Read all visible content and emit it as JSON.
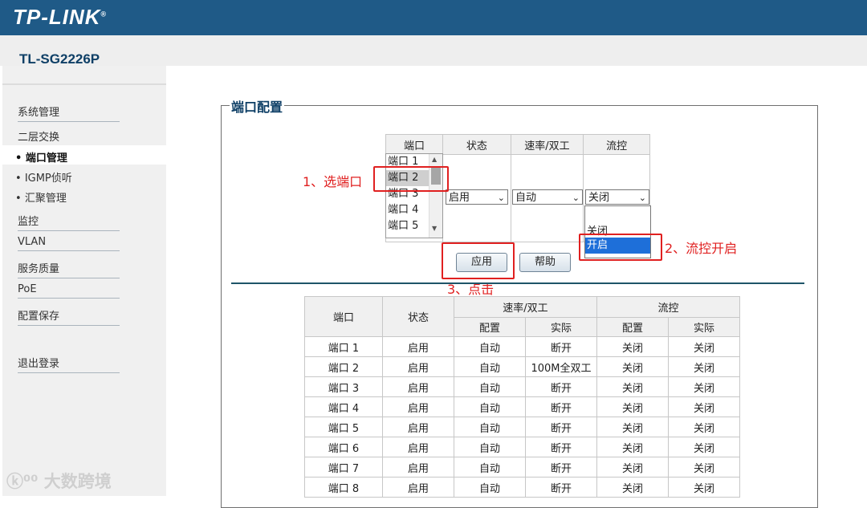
{
  "brand": "TP-LINK",
  "model": "TL-SG2226P",
  "sidebar": {
    "items": [
      {
        "label": "系统管理"
      },
      {
        "label": "二层交换"
      },
      {
        "label": "监控"
      },
      {
        "label": "VLAN"
      },
      {
        "label": "服务质量"
      },
      {
        "label": "PoE"
      },
      {
        "label": "配置保存"
      },
      {
        "label": "退出登录"
      }
    ],
    "subitems": [
      {
        "label": "端口管理",
        "active": true
      },
      {
        "label": "IGMP侦听",
        "active": false
      },
      {
        "label": "汇聚管理",
        "active": false
      }
    ]
  },
  "panel_title": "端口配置",
  "config": {
    "headers": [
      "端口",
      "状态",
      "速率/双工",
      "流控"
    ],
    "port_list": [
      "端口 1",
      "端口 2",
      "端口 3",
      "端口 4",
      "端口 5"
    ],
    "selected_port": "端口 2",
    "status_value": "启用",
    "speed_value": "自动",
    "flow_value": "关闭",
    "flow_options": [
      "关闭",
      "开启"
    ],
    "flow_highlighted": "开启",
    "apply_label": "应用",
    "help_label": "帮助"
  },
  "annotations": {
    "step1": "1、选端口",
    "step2": "2、流控开启",
    "step3": "3、点击"
  },
  "status_table": {
    "headers": {
      "port": "端口",
      "status": "状态",
      "speed": "速率/双工",
      "flow": "流控",
      "config": "配置",
      "actual": "实际"
    },
    "rows": [
      {
        "port": "端口 1",
        "status": "启用",
        "speed_cfg": "自动",
        "speed_act": "断开",
        "flow_cfg": "关闭",
        "flow_act": "关闭"
      },
      {
        "port": "端口 2",
        "status": "启用",
        "speed_cfg": "自动",
        "speed_act": "100M全双工",
        "flow_cfg": "关闭",
        "flow_act": "关闭"
      },
      {
        "port": "端口 3",
        "status": "启用",
        "speed_cfg": "自动",
        "speed_act": "断开",
        "flow_cfg": "关闭",
        "flow_act": "关闭"
      },
      {
        "port": "端口 4",
        "status": "启用",
        "speed_cfg": "自动",
        "speed_act": "断开",
        "flow_cfg": "关闭",
        "flow_act": "关闭"
      },
      {
        "port": "端口 5",
        "status": "启用",
        "speed_cfg": "自动",
        "speed_act": "断开",
        "flow_cfg": "关闭",
        "flow_act": "关闭"
      },
      {
        "port": "端口 6",
        "status": "启用",
        "speed_cfg": "自动",
        "speed_act": "断开",
        "flow_cfg": "关闭",
        "flow_act": "关闭"
      },
      {
        "port": "端口 7",
        "status": "启用",
        "speed_cfg": "自动",
        "speed_act": "断开",
        "flow_cfg": "关闭",
        "flow_act": "关闭"
      },
      {
        "port": "端口 8",
        "status": "启用",
        "speed_cfg": "自动",
        "speed_act": "断开",
        "flow_cfg": "关闭",
        "flow_act": "关闭"
      }
    ]
  },
  "watermark": "大数跨境",
  "colors": {
    "header": "#1f5a87",
    "accent_red": "#e02020",
    "select_blue": "#1e6fd9"
  }
}
